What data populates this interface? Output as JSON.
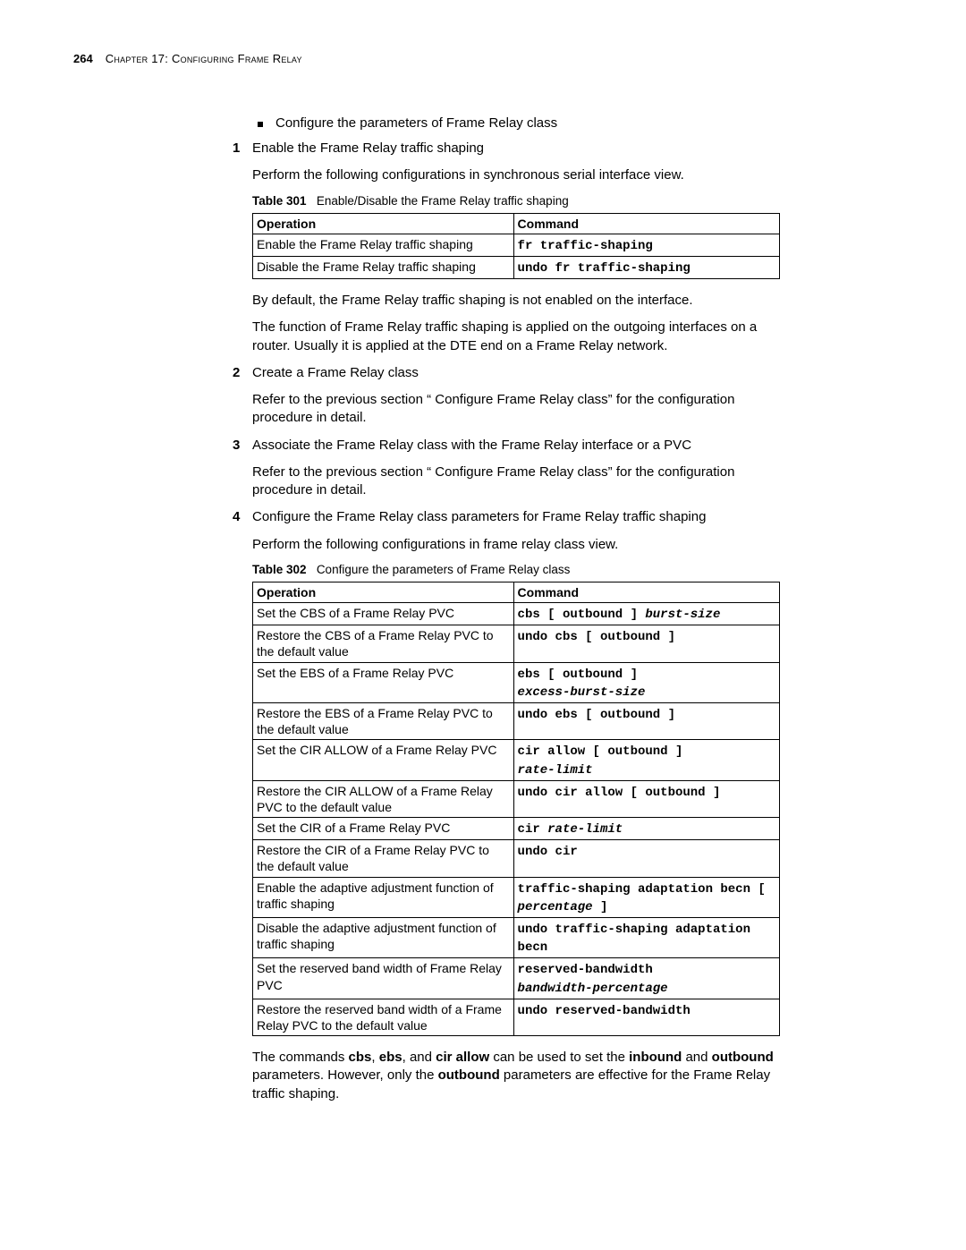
{
  "header": {
    "page": "264",
    "chapter": "Chapter 17: Configuring Frame Relay"
  },
  "bullet1": "Configure the parameters of Frame Relay class",
  "step1": {
    "num": "1",
    "title": "Enable the Frame Relay traffic shaping",
    "para": "Perform the following configurations in synchronous serial interface view."
  },
  "table301": {
    "caption_bold": "Table 301",
    "caption": "Enable/Disable the Frame Relay traffic shaping",
    "head_op": "Operation",
    "head_cmd": "Command",
    "r1_op": "Enable the Frame Relay traffic shaping",
    "r1_cmd": "fr traffic-shaping",
    "r2_op": "Disable the Frame Relay traffic shaping",
    "r2_cmd": "undo fr traffic-shaping"
  },
  "after_t301_p1": "By default, the Frame Relay traffic shaping is not enabled on the interface.",
  "after_t301_p2": "The function of Frame Relay traffic shaping is applied on the outgoing interfaces on a router. Usually it is applied at the DTE end on a Frame Relay network.",
  "step2": {
    "num": "2",
    "title": "Create a Frame Relay class",
    "para": "Refer to the previous section “ Configure Frame Relay class” for the configuration procedure in detail."
  },
  "step3": {
    "num": "3",
    "title": "Associate the Frame Relay class with the Frame Relay interface or a PVC",
    "para": "Refer to the previous section “ Configure Frame Relay class” for the configuration procedure in detail."
  },
  "step4": {
    "num": "4",
    "title": "Configure the Frame Relay class parameters for Frame Relay traffic shaping",
    "para": "Perform the following configurations in frame relay class view."
  },
  "table302": {
    "caption_bold": "Table 302",
    "caption": "Configure the parameters of Frame Relay class",
    "head_op": "Operation",
    "head_cmd": "Command",
    "rows": {
      "r1_op": "Set the CBS of a Frame Relay PVC",
      "r1_c1": "cbs [ outbound ] ",
      "r1_c2": "burst-size",
      "r2_op": "Restore the CBS of a Frame Relay PVC to the default value",
      "r2_c1": "undo cbs [ outbound ]",
      "r3_op": "Set the EBS of a Frame Relay PVC",
      "r3_c1": "ebs [ outbound ] ",
      "r3_c2": "excess-burst-size",
      "r4_op": "Restore the EBS of a Frame Relay PVC to the default value",
      "r4_c1": "undo ebs [ outbound ]",
      "r5_op": "Set the CIR ALLOW of a Frame Relay PVC",
      "r5_c1": "cir allow [ outbound ] ",
      "r5_c2": "rate-limit",
      "r6_op": "Restore the CIR ALLOW of a Frame Relay PVC to the default value",
      "r6_c1": "undo cir allow [ outbound ]",
      "r7_op": "Set the CIR of a Frame Relay PVC",
      "r7_c1": "cir ",
      "r7_c2": "rate-limit",
      "r8_op": "Restore the CIR of a Frame Relay PVC to the default value",
      "r8_c1": "undo cir",
      "r9_op": "Enable the adaptive adjustment function of traffic shaping",
      "r9_c1": "traffic-shaping adaptation becn [ ",
      "r9_c2": "percentage",
      "r9_c3": " ]",
      "r10_op": "Disable the adaptive adjustment function of traffic shaping",
      "r10_c1": "undo traffic-shaping adaptation becn",
      "r11_op": "Set the reserved band width of Frame Relay PVC",
      "r11_c1": "reserved-bandwidth ",
      "r11_c2": "bandwidth-percentage",
      "r12_op": "Restore the reserved band width of a Frame Relay PVC to the default value",
      "r12_c1": "undo reserved-bandwidth"
    }
  },
  "footer": {
    "p1a": "The commands ",
    "p1b": "cbs",
    "p1c": ", ",
    "p1d": "ebs",
    "p1e": ", and ",
    "p1f": "cir allow",
    "p1g": " can be used to set the ",
    "p1h": "inbound",
    "p1i": " and ",
    "p1j": "outbound",
    "p1k": " parameters. However, only the ",
    "p1l": "outbound",
    "p1m": " parameters are effective for the Frame Relay traffic shaping."
  }
}
